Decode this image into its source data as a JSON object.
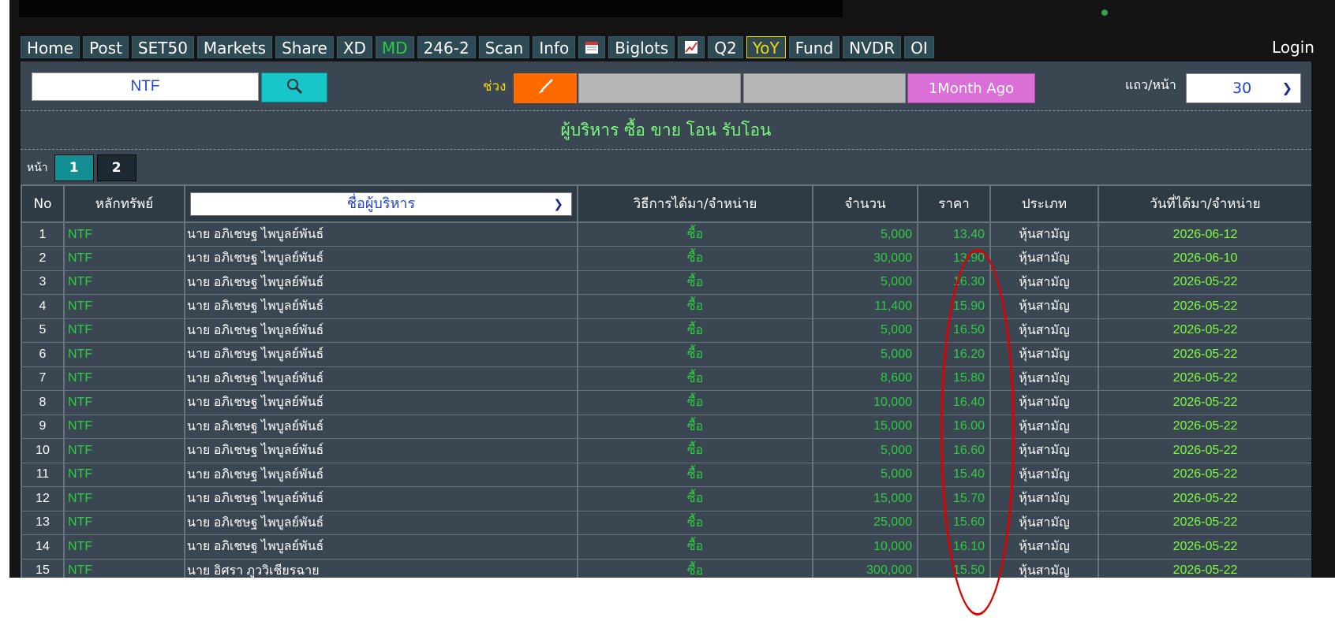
{
  "menu": {
    "items": [
      "Home",
      "Post",
      "SET50",
      "Markets",
      "Share",
      "XD",
      "MD",
      "246-2",
      "Scan",
      "Info"
    ],
    "items_after_calendar": [
      "Biglots"
    ],
    "items_after_chart": [
      "Q2",
      "YoY",
      "Fund",
      "NVDR",
      "OI"
    ],
    "login": "Login",
    "icons": [
      "calendar-icon",
      "chart-icon"
    ]
  },
  "search": {
    "symbol": "NTF",
    "range_label": "ช่วง",
    "preset_button": "1Month Ago",
    "rows_label": "แถว/หน้า",
    "rows_value": "30"
  },
  "title": "ผู้บริหาร ซื้อ ขาย โอน รับโอน",
  "pager": {
    "label": "หน้า",
    "pages": [
      "1",
      "2"
    ],
    "active": "1"
  },
  "table": {
    "headers": {
      "no": "No",
      "symbol": "หลักทรัพย์",
      "name": "ชื่อผู้บริหาร",
      "method": "วิธีการได้มา/จำหน่าย",
      "qty": "จำนวน",
      "price": "ราคา",
      "type": "ประเภท",
      "date": "วันที่ได้มา/จำหน่าย"
    },
    "rows": [
      {
        "no": "1",
        "symbol": "NTF",
        "name": "นาย อภิเชษฐ ไพบูลย์พันธ์",
        "method": "ซื้อ",
        "qty": "5,000",
        "price": "13.40",
        "type": "หุ้นสามัญ",
        "date": "2026-06-12"
      },
      {
        "no": "2",
        "symbol": "NTF",
        "name": "นาย อภิเชษฐ ไพบูลย์พันธ์",
        "method": "ซื้อ",
        "qty": "30,000",
        "price": "13.90",
        "type": "หุ้นสามัญ",
        "date": "2026-06-10"
      },
      {
        "no": "3",
        "symbol": "NTF",
        "name": "นาย อภิเชษฐ ไพบูลย์พันธ์",
        "method": "ซื้อ",
        "qty": "5,000",
        "price": "16.30",
        "type": "หุ้นสามัญ",
        "date": "2026-05-22"
      },
      {
        "no": "4",
        "symbol": "NTF",
        "name": "นาย อภิเชษฐ ไพบูลย์พันธ์",
        "method": "ซื้อ",
        "qty": "11,400",
        "price": "15.90",
        "type": "หุ้นสามัญ",
        "date": "2026-05-22"
      },
      {
        "no": "5",
        "symbol": "NTF",
        "name": "นาย อภิเชษฐ ไพบูลย์พันธ์",
        "method": "ซื้อ",
        "qty": "5,000",
        "price": "16.50",
        "type": "หุ้นสามัญ",
        "date": "2026-05-22"
      },
      {
        "no": "6",
        "symbol": "NTF",
        "name": "นาย อภิเชษฐ ไพบูลย์พันธ์",
        "method": "ซื้อ",
        "qty": "5,000",
        "price": "16.20",
        "type": "หุ้นสามัญ",
        "date": "2026-05-22"
      },
      {
        "no": "7",
        "symbol": "NTF",
        "name": "นาย อภิเชษฐ ไพบูลย์พันธ์",
        "method": "ซื้อ",
        "qty": "8,600",
        "price": "15.80",
        "type": "หุ้นสามัญ",
        "date": "2026-05-22"
      },
      {
        "no": "8",
        "symbol": "NTF",
        "name": "นาย อภิเชษฐ ไพบูลย์พันธ์",
        "method": "ซื้อ",
        "qty": "10,000",
        "price": "16.40",
        "type": "หุ้นสามัญ",
        "date": "2026-05-22"
      },
      {
        "no": "9",
        "symbol": "NTF",
        "name": "นาย อภิเชษฐ ไพบูลย์พันธ์",
        "method": "ซื้อ",
        "qty": "15,000",
        "price": "16.00",
        "type": "หุ้นสามัญ",
        "date": "2026-05-22"
      },
      {
        "no": "10",
        "symbol": "NTF",
        "name": "นาย อภิเชษฐ ไพบูลย์พันธ์",
        "method": "ซื้อ",
        "qty": "5,000",
        "price": "16.60",
        "type": "หุ้นสามัญ",
        "date": "2026-05-22"
      },
      {
        "no": "11",
        "symbol": "NTF",
        "name": "นาย อภิเชษฐ ไพบูลย์พันธ์",
        "method": "ซื้อ",
        "qty": "5,000",
        "price": "15.40",
        "type": "หุ้นสามัญ",
        "date": "2026-05-22"
      },
      {
        "no": "12",
        "symbol": "NTF",
        "name": "นาย อภิเชษฐ ไพบูลย์พันธ์",
        "method": "ซื้อ",
        "qty": "15,000",
        "price": "15.70",
        "type": "หุ้นสามัญ",
        "date": "2026-05-22"
      },
      {
        "no": "13",
        "symbol": "NTF",
        "name": "นาย อภิเชษฐ ไพบูลย์พันธ์",
        "method": "ซื้อ",
        "qty": "25,000",
        "price": "15.60",
        "type": "หุ้นสามัญ",
        "date": "2026-05-22"
      },
      {
        "no": "14",
        "symbol": "NTF",
        "name": "นาย อภิเชษฐ ไพบูลย์พันธ์",
        "method": "ซื้อ",
        "qty": "10,000",
        "price": "16.10",
        "type": "หุ้นสามัญ",
        "date": "2026-05-22"
      },
      {
        "no": "15",
        "symbol": "NTF",
        "name": "นาย อิศรา ภูววิเชียรฉาย",
        "method": "ซื้อ",
        "qty": "300,000",
        "price": "15.50",
        "type": "หุ้นสามัญ",
        "date": "2026-05-22"
      }
    ]
  },
  "colors": {
    "accent_green": "#2ecc40",
    "annotation_red": "#e00000",
    "search_button": "#17c6c9",
    "brush_button": "#ff6a00",
    "preset_button": "#da6fd8",
    "active_page": "#138f93"
  }
}
